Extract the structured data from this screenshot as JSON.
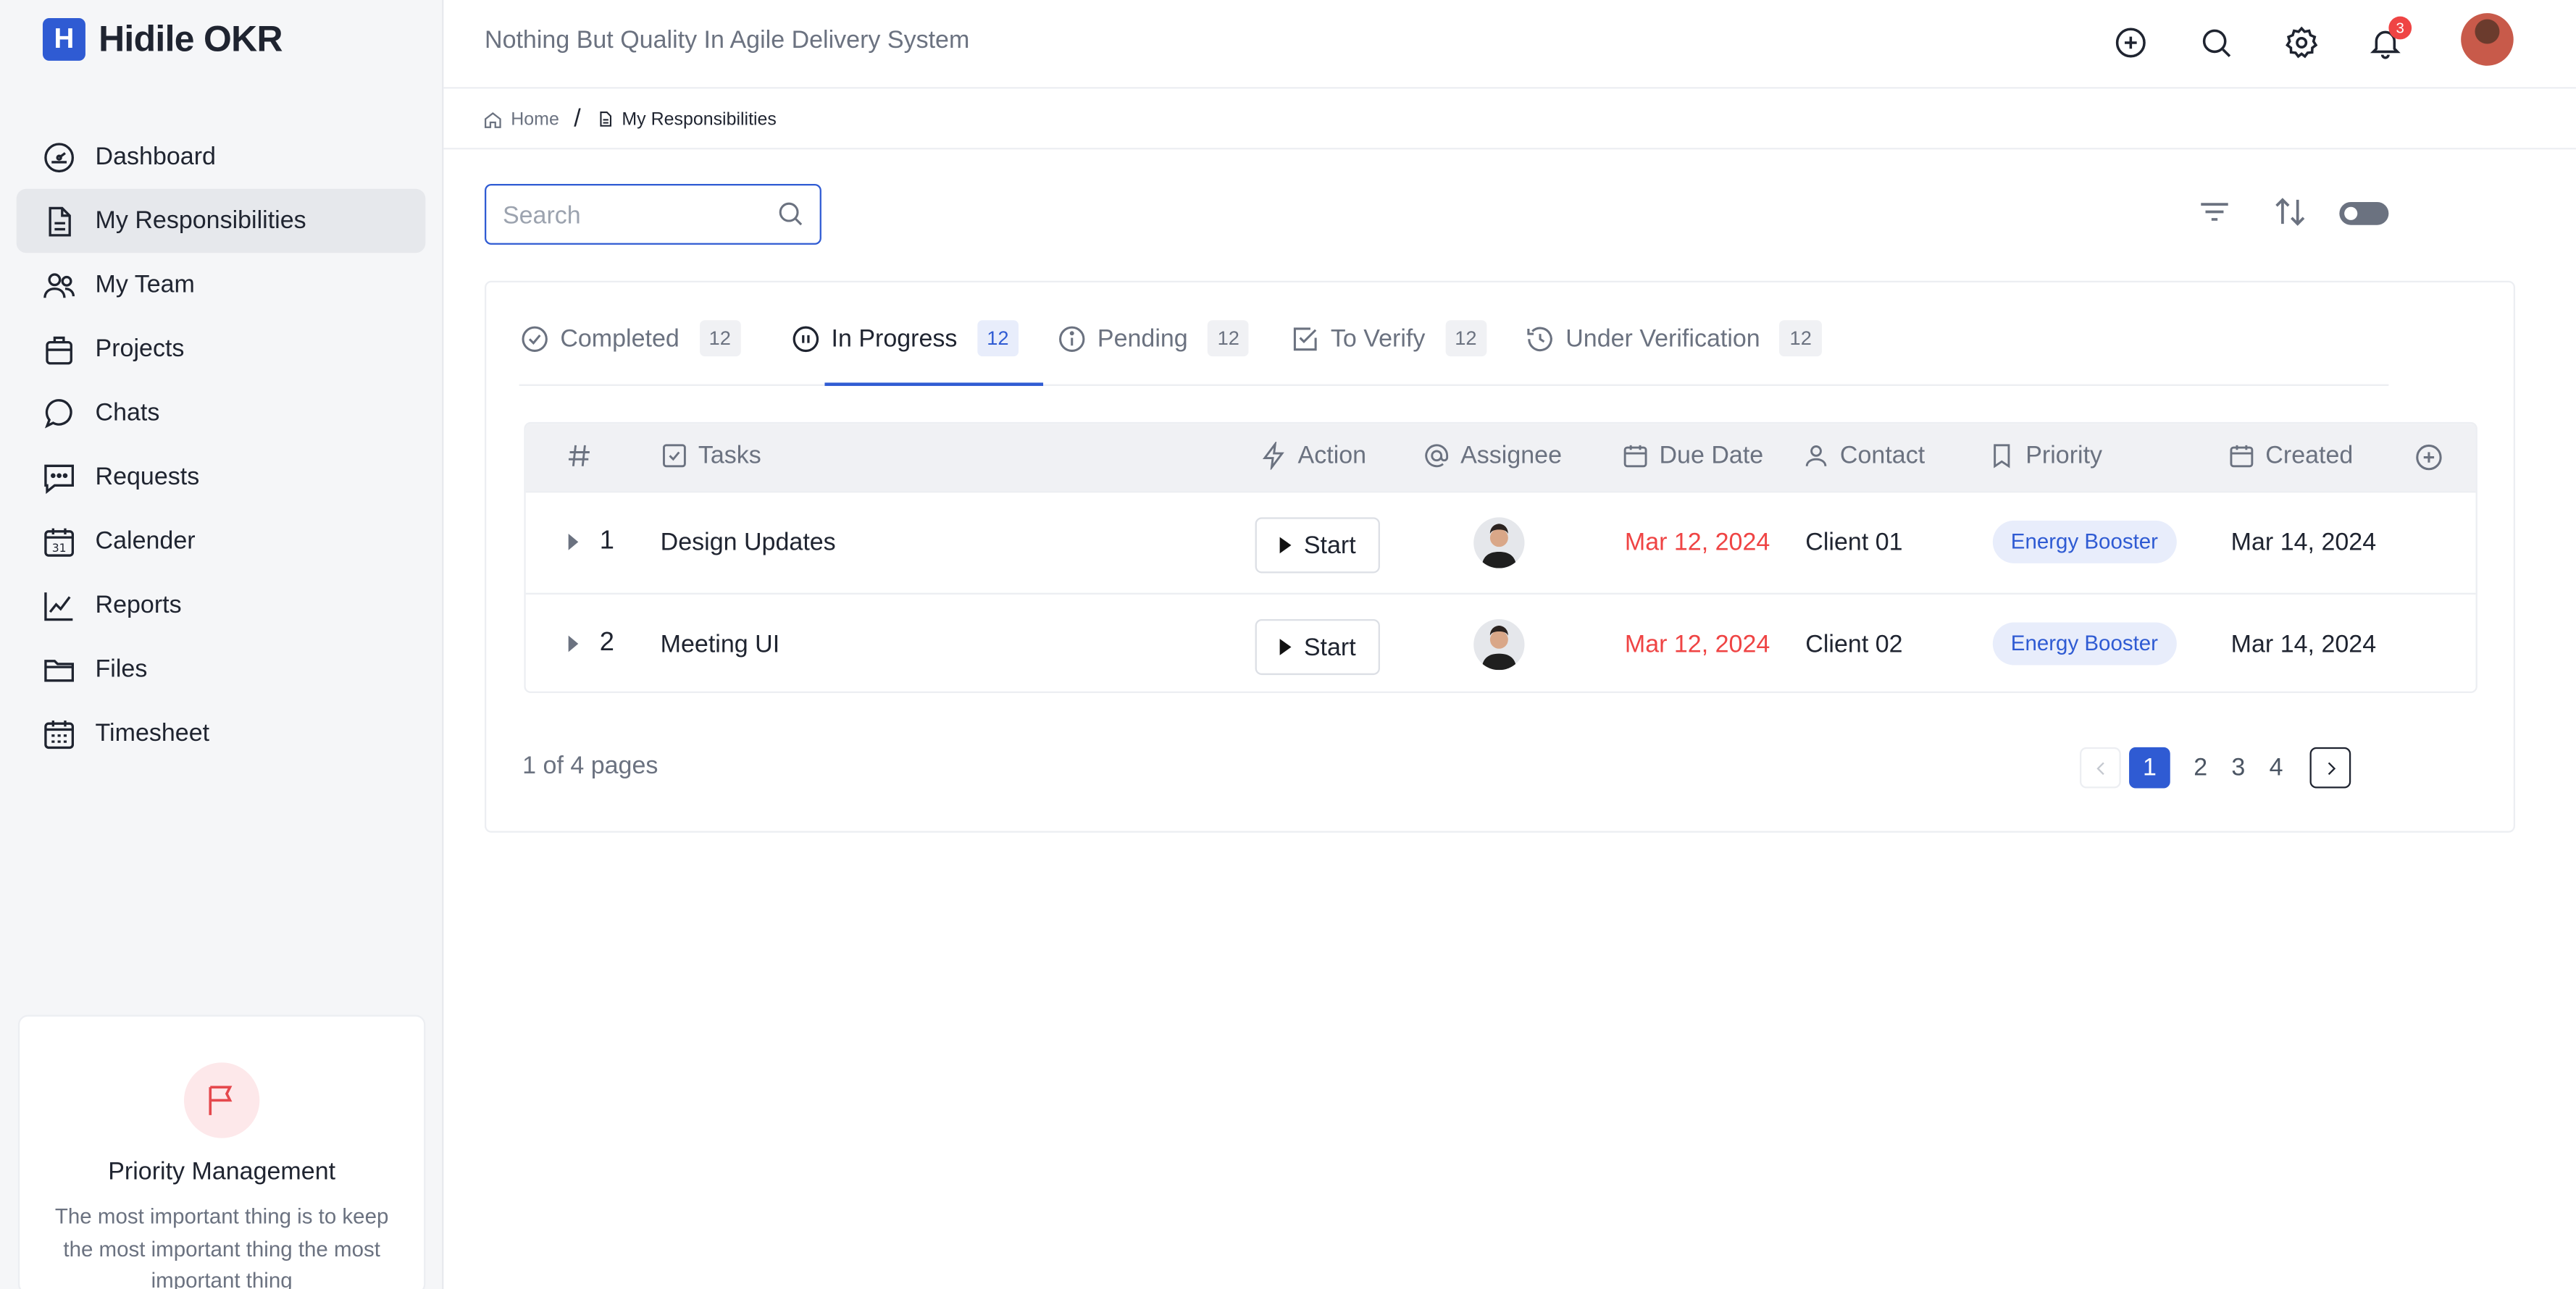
{
  "brand": {
    "badge": "H",
    "name": "Hidile OKR"
  },
  "header": {
    "tagline": "Nothing But Quality In Agile Delivery System",
    "notifications_count": "3"
  },
  "sidebar": {
    "items": [
      {
        "label": "Dashboard",
        "icon": "dashboard-icon",
        "active": false
      },
      {
        "label": "My Responsibilities",
        "icon": "document-icon",
        "active": true
      },
      {
        "label": "My Team",
        "icon": "team-icon",
        "active": false
      },
      {
        "label": "Projects",
        "icon": "briefcase-icon",
        "active": false
      },
      {
        "label": "Chats",
        "icon": "chat-icon",
        "active": false
      },
      {
        "label": "Requests",
        "icon": "message-icon",
        "active": false
      },
      {
        "label": "Calender",
        "icon": "calendar-icon",
        "active": false
      },
      {
        "label": "Reports",
        "icon": "chart-icon",
        "active": false
      },
      {
        "label": "Files",
        "icon": "folder-icon",
        "active": false
      },
      {
        "label": "Timesheet",
        "icon": "timesheet-icon",
        "active": false
      }
    ],
    "promo": {
      "title": "Priority Management",
      "text": "The most important thing is to keep the most important thing the most important thing"
    }
  },
  "breadcrumb": {
    "home": "Home",
    "separator": "/",
    "current": "My Responsibilities"
  },
  "search": {
    "placeholder": "Search",
    "value": ""
  },
  "tabs": [
    {
      "label": "Completed",
      "count": "12",
      "active": false
    },
    {
      "label": "In Progress",
      "count": "12",
      "active": true
    },
    {
      "label": "Pending",
      "count": "12",
      "active": false
    },
    {
      "label": "To Verify",
      "count": "12",
      "active": false
    },
    {
      "label": "Under Verification",
      "count": "12",
      "active": false
    }
  ],
  "table": {
    "columns": {
      "num": "#",
      "tasks": "Tasks",
      "action": "Action",
      "assignee": "Assignee",
      "due": "Due Date",
      "contact": "Contact",
      "priority": "Priority",
      "created": "Created"
    },
    "rows": [
      {
        "num": "1",
        "task": "Design Updates",
        "action": "Start",
        "due": "Mar 12, 2024",
        "contact": "Client 01",
        "priority": "Energy Booster",
        "created": "Mar 14, 2024"
      },
      {
        "num": "2",
        "task": "Meeting UI",
        "action": "Start",
        "due": "Mar 12, 2024",
        "contact": "Client 02",
        "priority": "Energy Booster",
        "created": "Mar 14, 2024"
      }
    ]
  },
  "pagination": {
    "info": "1 of 4 pages",
    "pages": [
      "1",
      "2",
      "3",
      "4"
    ],
    "current": "1"
  },
  "colors": {
    "accent": "#2f5bd3",
    "danger": "#ef4444",
    "muted": "#6b7280"
  }
}
